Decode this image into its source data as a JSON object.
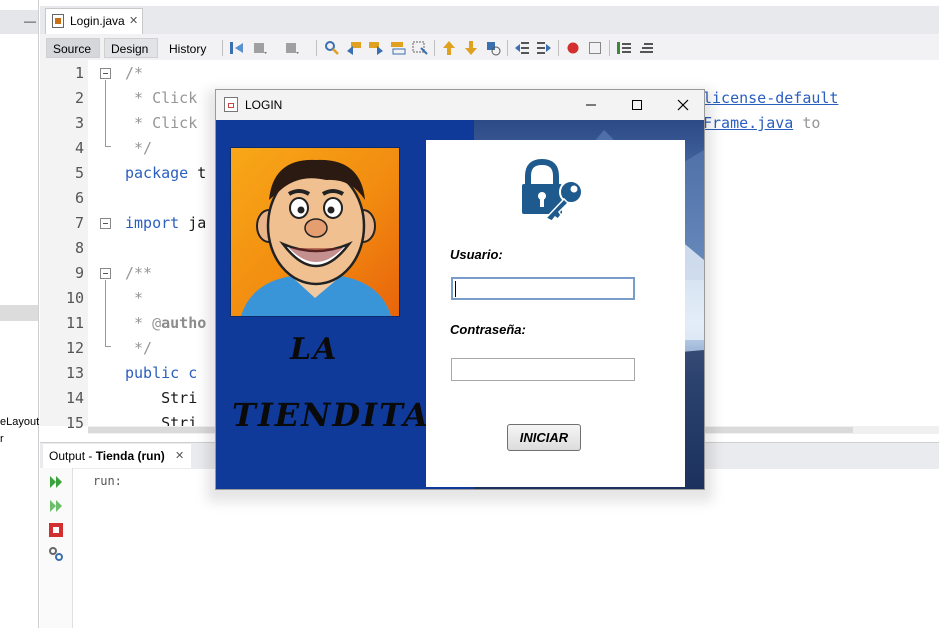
{
  "ide": {
    "left_panel": {
      "minimize_glyph": "—",
      "texts": [
        "eLayout",
        "r"
      ]
    },
    "editor_tab": {
      "label": "Login.java",
      "close": "✕"
    },
    "view_tabs": [
      "Source",
      "Design",
      "History"
    ],
    "toolbar_icons": [
      "toggle-bookmark-icon",
      "back-icon",
      "forward-icon",
      "find-icon",
      "find-prev-icon",
      "find-next-icon",
      "find-selection-icon",
      "toggle-highlight-icon",
      "prev-bookmark-icon",
      "next-bookmark-icon",
      "toggle-bookmark2-icon",
      "shift-left-icon",
      "shift-right-icon",
      "record-macro-icon",
      "stop-macro-icon",
      "comment-icon",
      "uncomment-icon"
    ],
    "code_lines": [
      {
        "n": "1",
        "parts": [
          {
            "t": "/*",
            "c": "cmt"
          }
        ]
      },
      {
        "n": "2",
        "parts": [
          {
            "t": " * Click",
            "c": "cmt"
          },
          {
            "t": "                                                 ",
            "c": "plain"
          },
          {
            "t": "censes/license-default",
            "c": "link"
          }
        ]
      },
      {
        "n": "3",
        "parts": [
          {
            "t": " * Click",
            "c": "cmt"
          },
          {
            "t": "                                                 ",
            "c": "plain"
          },
          {
            "t": "Forms/JFrame.java",
            "c": "link"
          },
          {
            "t": " to",
            "c": "cmt"
          }
        ]
      },
      {
        "n": "4",
        "parts": [
          {
            "t": " */",
            "c": "cmt"
          }
        ]
      },
      {
        "n": "5",
        "parts": [
          {
            "t": "package",
            "c": "kw"
          },
          {
            "t": " t",
            "c": "plain"
          }
        ]
      },
      {
        "n": "6",
        "parts": []
      },
      {
        "n": "7",
        "parts": [
          {
            "t": "import",
            "c": "kw"
          },
          {
            "t": " ja",
            "c": "plain"
          }
        ]
      },
      {
        "n": "8",
        "parts": []
      },
      {
        "n": "9",
        "parts": [
          {
            "t": "/**",
            "c": "cmt"
          }
        ]
      },
      {
        "n": "10",
        "parts": [
          {
            "t": " *",
            "c": "cmt"
          }
        ]
      },
      {
        "n": "11",
        "parts": [
          {
            "t": " * @",
            "c": "cmt"
          },
          {
            "t": "autho",
            "c": "bold-cmt"
          }
        ]
      },
      {
        "n": "12",
        "parts": [
          {
            "t": " */",
            "c": "cmt"
          }
        ]
      },
      {
        "n": "13",
        "parts": [
          {
            "t": "public",
            "c": "kw"
          },
          {
            "t": " c",
            "c": "kw"
          }
        ]
      },
      {
        "n": "14",
        "parts": [
          {
            "t": "    Stri",
            "c": "plain"
          }
        ]
      },
      {
        "n": "15",
        "parts": [
          {
            "t": "    Stri",
            "c": "plain"
          }
        ]
      }
    ],
    "output": {
      "tab_prefix": "Output - ",
      "tab_project": "Tienda (run)",
      "close": "✕",
      "text": "run:"
    }
  },
  "dialog": {
    "title": "LOGIN",
    "brand_line1": "LA",
    "brand_line2": "TIENDITA",
    "usuario_label": "Usuario:",
    "usuario_value": "",
    "password_label": "Contraseña:",
    "password_value": "",
    "submit_label": "INICIAR",
    "colors": {
      "left_bg": "#0f3a99",
      "accent": "#1e5a8e",
      "avatar_bg": "#f28c10"
    }
  }
}
